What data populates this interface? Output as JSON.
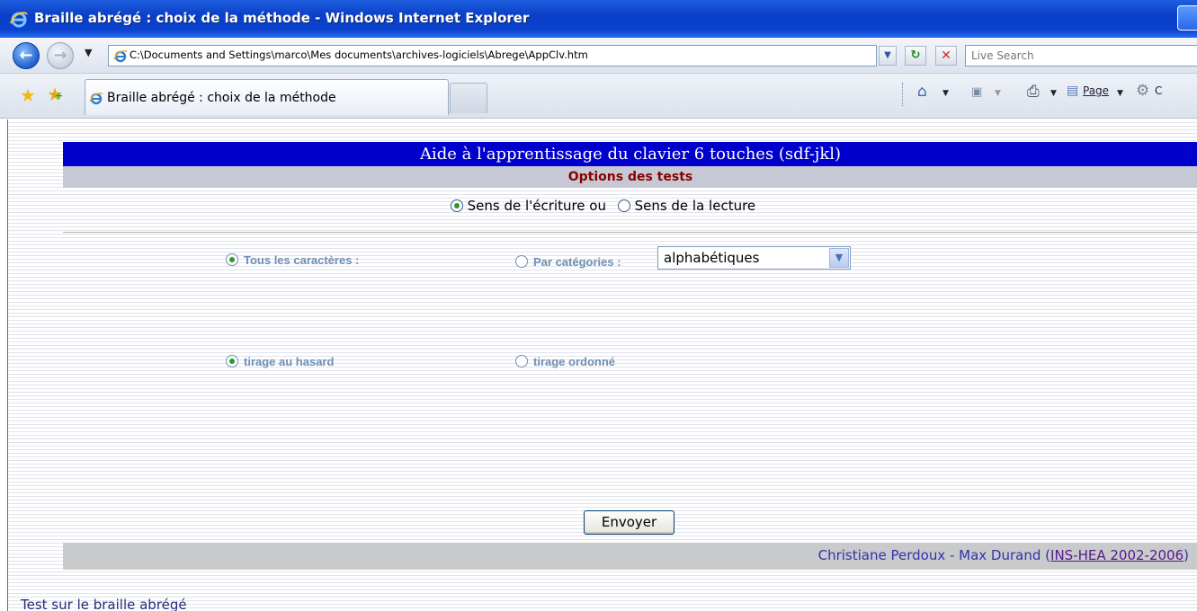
{
  "window": {
    "title": "Braille abrégé : choix de la méthode - Windows Internet Explorer"
  },
  "address_bar": {
    "url": "C:\\Documents and Settings\\marco\\Mes documents\\archives-logiciels\\Abrege\\AppClv.htm",
    "search_placeholder": "Live Search"
  },
  "tabs": [
    {
      "label": "Braille abrégé : choix de la méthode",
      "active": true
    }
  ],
  "command_bar": {
    "page_label": "Page",
    "tools_label_partial": "C"
  },
  "page": {
    "heading": "Aide à l'apprentissage du clavier 6 touches (sdf-jkl)",
    "subheading": "Options des tests",
    "direction": {
      "writing_label": "Sens de l'écriture ou",
      "reading_label": "Sens de la lecture",
      "selected": "writing"
    },
    "characters": {
      "all_label": "Tous les caractères :",
      "by_category_label": "Par catégories :",
      "selected": "all",
      "category_value": "alphabétiques"
    },
    "draw": {
      "random_label": "tirage au hasard",
      "ordered_label": "tirage ordonné",
      "selected": "random"
    },
    "submit_label": "Envoyer",
    "credits_text": "Christiane Perdoux - Max Durand (",
    "credits_link": "INS-HEA 2002-2006",
    "credits_close": ")",
    "bottom_text": "Test sur le braille abrégé"
  },
  "colors": {
    "heading_bg": "#0000cc",
    "subheading_bg": "#c6c9d4",
    "subheading_text": "#8b0000",
    "option_text": "#6f8fb3",
    "title_bar": "#0a43cf"
  }
}
